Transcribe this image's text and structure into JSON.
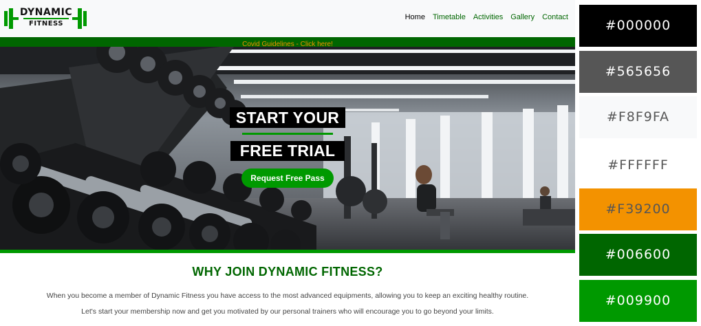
{
  "header": {
    "logo_line1": "DYNAMIC",
    "logo_line2": "FITNESS",
    "nav": [
      "Home",
      "Timetable",
      "Activities",
      "Gallery",
      "Contact"
    ],
    "active_nav": "Home"
  },
  "banner": {
    "covid_link": "Covid Guidelines - Click here!"
  },
  "hero": {
    "title_line1": "START YOUR",
    "title_line2": "FREE TRIAL",
    "cta": "Request Free Pass"
  },
  "about": {
    "title": "WHY JOIN DYNAMIC FITNESS?",
    "paragraph1": "When you become a member of Dynamic Fitness you have access to the most advanced equipments, allowing you to keep an exciting healthy routine.",
    "paragraph2": "Let's start your membership now and get you motivated by our personal trainers who will encourage you to go beyond your limits."
  },
  "palette": [
    {
      "label": "#000000",
      "color": "#000000",
      "text_color": "#ffffff"
    },
    {
      "label": "#565656",
      "color": "#565656",
      "text_color": "#ffffff"
    },
    {
      "label": "#F8F9FA",
      "color": "#F8F9FA",
      "text_color": "#565656"
    },
    {
      "label": "#FFFFFF",
      "color": "#FFFFFF",
      "text_color": "#565656"
    },
    {
      "label": "#F39200",
      "color": "#F39200",
      "text_color": "#565656"
    },
    {
      "label": "#006600",
      "color": "#006600",
      "text_color": "#ffffff"
    },
    {
      "label": "#009900",
      "color": "#009900",
      "text_color": "#ffffff"
    }
  ]
}
